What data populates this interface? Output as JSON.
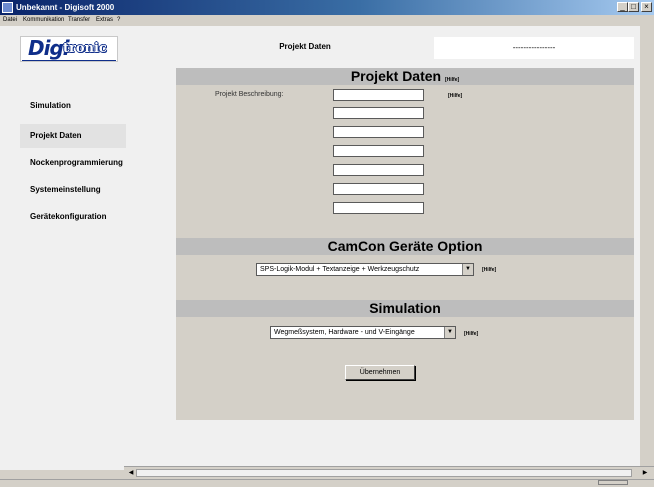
{
  "window": {
    "title": "Unbekannt - Digisoft 2000",
    "controls": {
      "minimize": "_",
      "maximize": "□",
      "close": "×"
    }
  },
  "menu": [
    "Datei",
    "Kommunikation",
    "Transfer",
    "Extras",
    "?"
  ],
  "logo": {
    "part1": "Digi",
    "part2": "tronic"
  },
  "header": {
    "title": "Projekt Daten",
    "right_value": "----------------"
  },
  "sidebar": {
    "items": [
      {
        "label": "Simulation"
      },
      {
        "label": "Projekt Daten"
      },
      {
        "label": "Nockenprogrammierung"
      },
      {
        "label": "Systemeinstellung"
      },
      {
        "label": "Gerätekonfiguration"
      }
    ],
    "active_index": 1
  },
  "projekt": {
    "title": "Projekt Daten",
    "hilfe": "[Hilfe]",
    "beschreibung_label": "Projekt Beschreibung:",
    "beschreibung_hilfe": "[Hilfe]",
    "fields": [
      "",
      "",
      "",
      "",
      "",
      "",
      ""
    ]
  },
  "camcon": {
    "title": "CamCon Geräte Option",
    "selected": "SPS-Logik-Modul + Textanzeige + Werkzeugschutz",
    "hilfe": "[Hilfe]"
  },
  "simulation": {
    "title": "Simulation",
    "selected": "Wegmeßsystem, Hardware - und V-Eingänge",
    "hilfe": "[Hilfe]"
  },
  "actions": {
    "apply_label": "Übernehmen"
  },
  "colors": {
    "titlebar_start": "#0a246a",
    "titlebar_end": "#a6caf0",
    "section_header": "#bdbdbd",
    "logo_blue": "#0f2e8a"
  }
}
